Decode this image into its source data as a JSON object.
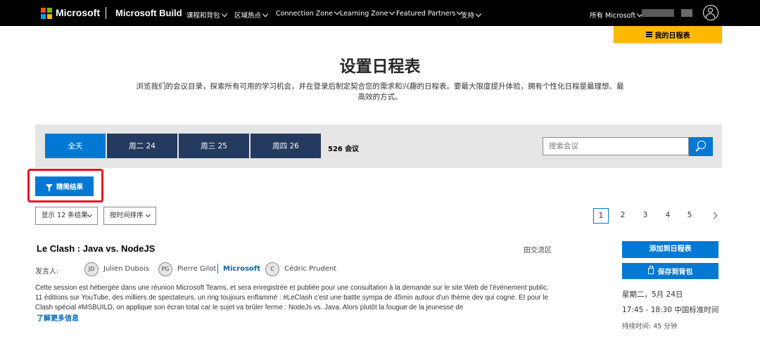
{
  "colors": {
    "accent": "#0078d4",
    "navy": "#243a5e",
    "highlight": "#e81123",
    "schedule_yellow": "#ffb900"
  },
  "header": {
    "logo_icon": "microsoft-logo-icon",
    "brand": "Microsoft",
    "site_name": "Microsoft Build",
    "nav": [
      "课程和背包",
      "区域热点",
      "Connection Zone",
      "Learning Zone",
      "Featured Partners",
      "支持"
    ],
    "all_microsoft": "所有 Microsoft",
    "account_icon": "account-icon"
  },
  "my_schedule": {
    "label": "我的日程表",
    "icon": "list-icon"
  },
  "page": {
    "title": "设置日程表",
    "intro": "浏览我们的会议目录，探索所有可用的学习机会，并在登录后制定契合您的需求和兴趣的日程表。要最大限度提升体验，拥有个性化日程是最理想、最高效的方式。"
  },
  "filters": {
    "days": [
      "全天",
      "周二 24",
      "周三 25",
      "周四 26"
    ],
    "count_number": "526",
    "count_label": "会议",
    "search_placeholder": "搜索会议",
    "refine_label": "精简结果",
    "show_select": "显示 12 条结果",
    "sort_select": "按时间排序"
  },
  "pagination": [
    "1",
    "2",
    "3",
    "4",
    "5"
  ],
  "session": {
    "title": "Le Clash : Java vs. NodeJS",
    "location": "田交流区",
    "speakers_label": "发言人:",
    "speakers": [
      {
        "initials": "JD",
        "name": "Julien Dubois"
      },
      {
        "initials": "PG",
        "name": "Pierre Gilot"
      },
      {
        "initials": "C",
        "name": "Cédric Prudent"
      }
    ],
    "org": "Microsoft",
    "description": "Cette session est hébergée dans une réunion Microsoft Teams, et sera enregistrée et publiée pour une consultation à la demande sur le site Web de l'événement public. 11 éditions sur YouTube, des milliers de spectateurs, un ring toujours enflammé : #LeClash c'est une battle sympa de 45min autour d'un thème dev qui cogne. Et pour le Clash spécial #MSBUILD, on applique son écran total car le sujet va brûler ferme : NodeJs vs. Java. Alors plutôt la fougue de la jeunesse de",
    "more_link": "了解更多信息",
    "add_button": "添加到日程表",
    "save_button": "保存到背包",
    "date": "星期二，5月 24日",
    "time": "17:45 - 18:30 中国标准时间",
    "duration_label": "持续时间:",
    "duration_value": "45 分钟"
  }
}
